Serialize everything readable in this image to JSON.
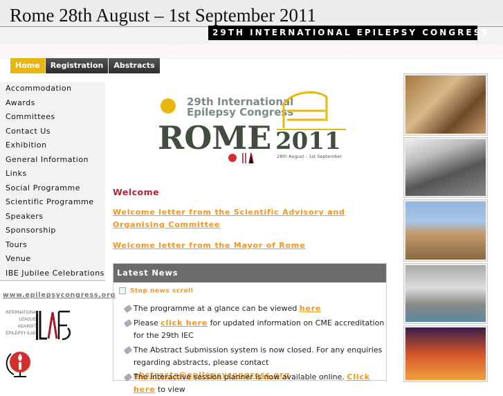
{
  "header": {
    "title": "Rome 28th August – 1st September 2011",
    "banner": "29TH INTERNATIONAL EPILEPSY CONGRESS"
  },
  "nav": [
    {
      "label": "Home"
    },
    {
      "label": "Registration"
    },
    {
      "label": "Abstracts"
    }
  ],
  "sidebar": {
    "items": [
      "Accommodation",
      "Awards",
      "Committees",
      "Contact Us",
      "Exhibition",
      "General Information",
      "Links",
      "Social Programme",
      "Scientific Programme",
      "Speakers",
      "Sponsorship",
      "Tours",
      "Venue",
      "IBE Jubilee Celebrations"
    ],
    "site_link": "www.epilepsycongress.org",
    "ilae_logo_text": "INTERNATIONAL LEAGUE AGAINST EPILEPSY ILAE"
  },
  "logo": {
    "line1": "29th International",
    "line2": "Epilepsy Congress",
    "rome": "ROME",
    "year": "2011",
    "dates": "28th August - 1st September"
  },
  "main": {
    "welcome": "Welcome",
    "link1": "Welcome letter from the Scientific Advisory and Organising Committee",
    "link2": "Welcome letter from the Mayor of Rome"
  },
  "news": {
    "title": "Latest News",
    "stop": "Stop news scroll",
    "i1": {
      "text": "The programme at a glance can be viewed ",
      "link": "here"
    },
    "i2": {
      "pre": "Please ",
      "link": "click here",
      "post": " for updated information on CME accreditation for the 29th IEC"
    },
    "i3": {
      "text": "The Abstract Submission system is now closed. For any enquiries regarding abstracts, please contact ",
      "link": "abstracts@epilepsycongress.org"
    },
    "i4": {
      "text": "The interactive session planner is now available online. ",
      "link": "Click here",
      "post": " to view"
    }
  },
  "colors": {
    "accent": "#e8b70f",
    "link": "#f7941d",
    "welcome": "#b02537"
  }
}
